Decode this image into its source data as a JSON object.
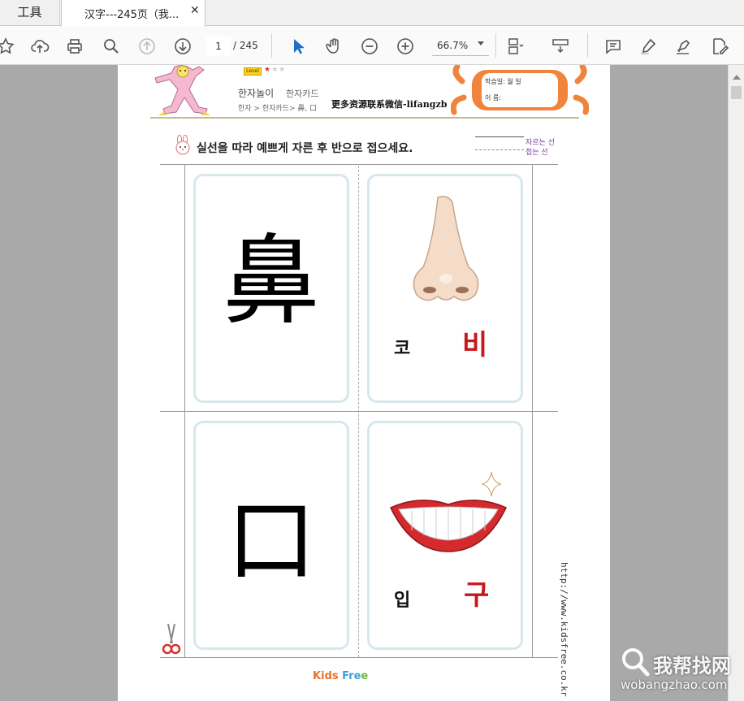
{
  "tabs": {
    "tools_label": "工具",
    "document_label": "汉字---245页（我...",
    "close_glyph": "✕"
  },
  "toolbar": {
    "current_page": "1",
    "total_pages": "/ 245",
    "zoom": "66.7%",
    "icons": [
      "star-icon",
      "cloud-upload-icon",
      "print-icon",
      "zoom-search-icon",
      "page-up-icon",
      "page-down-icon",
      "select-cursor-icon",
      "hand-icon",
      "zoom-out-icon",
      "zoom-in-icon",
      "page-layout-icon",
      "scroll-mode-icon",
      "comment-icon",
      "highlight-icon",
      "sign-icon",
      "edit-pdf-icon"
    ]
  },
  "page": {
    "level_badge": "Level",
    "stars": {
      "on": "★",
      "off": "★★"
    },
    "title1": "한자놀이",
    "title2": "한자카드",
    "breadcrumb": "한자 > 한자카드> 鼻, 口",
    "watermark": "更多资源联系微信-lifangzb",
    "date_label": "학습일:     월     일",
    "name_label": "이  름:",
    "instruction": "실선을 따라 예쁘게 자른 후 반으로 접으세요.",
    "legend_cut": "자르는 선",
    "legend_fold": "접는 선",
    "cards": [
      {
        "hanja": "鼻",
        "meaning": "코",
        "sound": "비",
        "picture": "nose"
      },
      {
        "hanja": "口",
        "meaning": "입",
        "sound": "구",
        "picture": "mouth"
      }
    ],
    "url": "http://www.kidsfree.co.kr",
    "brand": {
      "part1": "Kids",
      "part2": " Fre",
      "part3": "e"
    }
  },
  "site_logo": {
    "main": "我帮找网",
    "sub": "wobangzhao.com"
  },
  "colors": {
    "sound_red": "#c8181e",
    "card_border": "#d6e8ec",
    "viewer_bg": "#a9a9a9",
    "crab_orange": "#f0843c"
  }
}
